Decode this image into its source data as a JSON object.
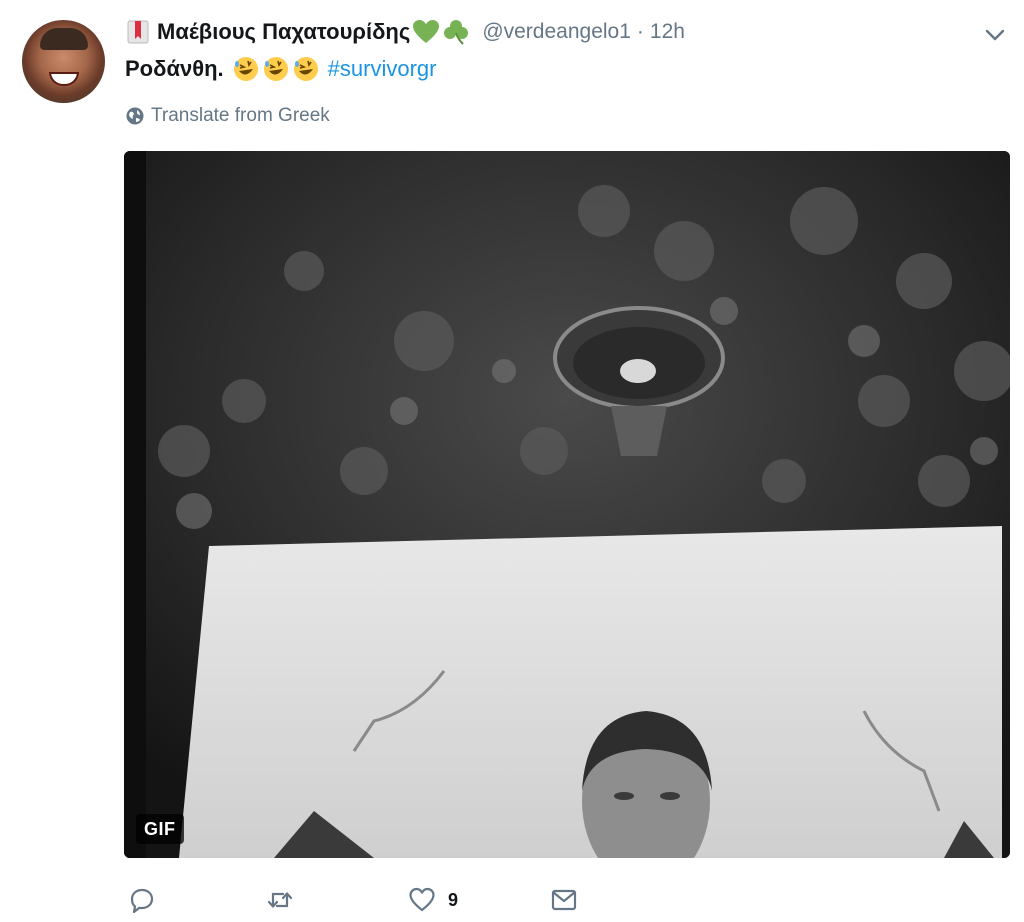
{
  "tweet": {
    "display_name": "Μαέβιους Παχατουρίδης",
    "handle": "@verdeangelo1",
    "separator": "·",
    "time": "12h",
    "text": "Ροδάνθη.",
    "emojis": [
      "rolling-on-floor-laughing",
      "rolling-on-floor-laughing",
      "rolling-on-floor-laughing"
    ],
    "hashtag": "#survivorgr",
    "translate_label": "Translate from Greek"
  },
  "media": {
    "badge": "GIF"
  },
  "actions": {
    "reply_count": "",
    "retweet_count": "",
    "like_count": "9",
    "message_count": ""
  },
  "icons": {
    "bookmark": "bookmark-icon",
    "heart": "green-heart-icon",
    "shamrock": "shamrock-icon",
    "caret": "chevron-down-icon",
    "globe": "globe-icon",
    "reply": "reply-icon",
    "retweet": "retweet-icon",
    "like": "like-icon",
    "message": "message-icon"
  },
  "colors": {
    "link": "#1b95e0",
    "secondary_text": "#657786",
    "primary_text": "#14171a",
    "heart_green": "#77b255"
  }
}
